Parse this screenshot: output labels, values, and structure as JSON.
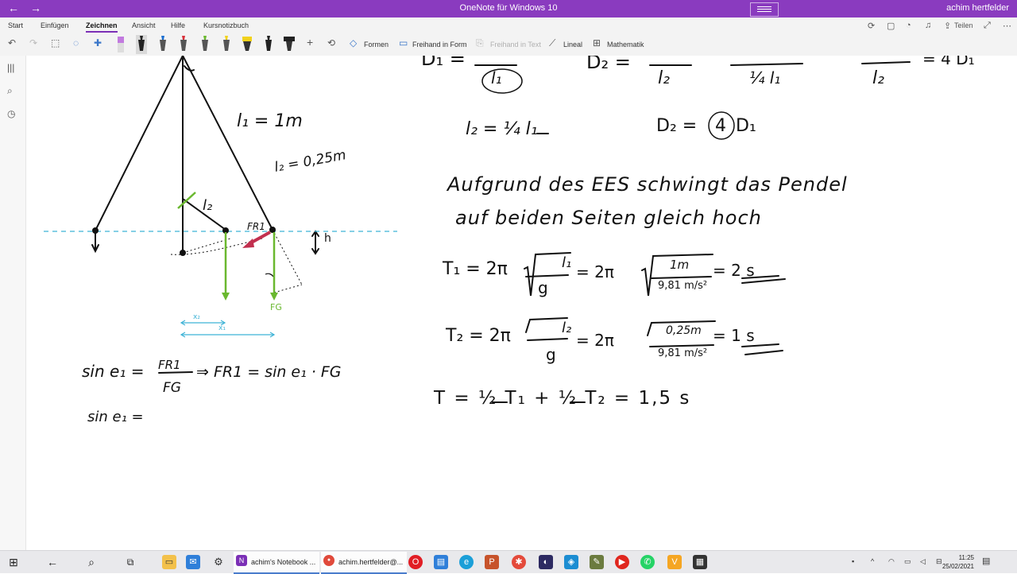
{
  "window": {
    "title": "OneNote für Windows 10",
    "user": "achim hertfelder",
    "back_icon": "back-arrow-icon",
    "forward_icon": "forward-arrow-icon"
  },
  "tabs": [
    {
      "label": "Start",
      "active": false
    },
    {
      "label": "Einfügen",
      "active": false
    },
    {
      "label": "Zeichnen",
      "active": true
    },
    {
      "label": "Ansicht",
      "active": false
    },
    {
      "label": "Hilfe",
      "active": false
    },
    {
      "label": "Kursnotizbuch",
      "active": false
    }
  ],
  "toolbar": {
    "formen": "Formen",
    "freihand_in_form": "Freihand in Form",
    "freihand_in_text": "Freihand in Text",
    "lineal": "Lineal",
    "mathematik": "Mathematik",
    "teilen": "Teilen",
    "pen_colors": [
      "#c27adf",
      "#222222",
      "#1d6fd1",
      "#d8303a",
      "#6ab82f",
      "#f2d21b",
      "#f2d21b",
      "#222222",
      "#222222"
    ]
  },
  "notes": {
    "eq_top_left": "D₁ =",
    "eq_top_l1": "l₁",
    "eq_top_D2": "D₂ =",
    "eq_top_frac_a": "l₂",
    "eq_top_frac_b": "¼ l₁",
    "eq_top_frac_c": "l₂",
    "eq_top_tail": "= 4 D₁",
    "l1_label": "l₁ = 1m",
    "l2_label": "l₂ = 0,25m",
    "l2_short": "l₂",
    "h_label": "h",
    "fr_label": "FR1",
    "fg_label": "FG",
    "x1_label": "x₁",
    "x2_label": "x₂",
    "eq_l2": "l₂ = ¼ l₁",
    "eq_D2": "D₂ =",
    "eq_D2_4": "4",
    "eq_D2_tail": "D₁",
    "text_line1": "Aufgrund des EES schwingt das Pendel",
    "text_line2": "auf beiden Seiten gleich hoch",
    "T1_lhs": "T₁ = 2π",
    "T1_frac_num": "l₁",
    "T1_frac_den": "g",
    "T1_mid": "= 2π",
    "T1_num": "1m",
    "T1_den": "9,81 m/s²",
    "T1_res": "= 2 s",
    "T2_lhs": "T₂ = 2π",
    "T2_frac_num": "l₂",
    "T2_frac_den": "g",
    "T2_mid": "= 2π",
    "T2_num": "0,25m",
    "T2_den": "9,81 m/s²",
    "T2_res": "= 1 s",
    "T_total": "T = ½ T₁ + ½ T₂ = 1,5 s",
    "sin_lhs": "sin e₁ =",
    "sin_num": "FR1",
    "sin_den": "FG",
    "sin_rhs": "⇒ FR1 = sin e₁ · FG",
    "sin_line2": "sin e₁ ="
  },
  "taskbar": {
    "onenote_label": "achim's Notebook ...",
    "chrome_label": "achim.hertfelder@...",
    "time": "11:25",
    "date": "25/02/2021"
  }
}
